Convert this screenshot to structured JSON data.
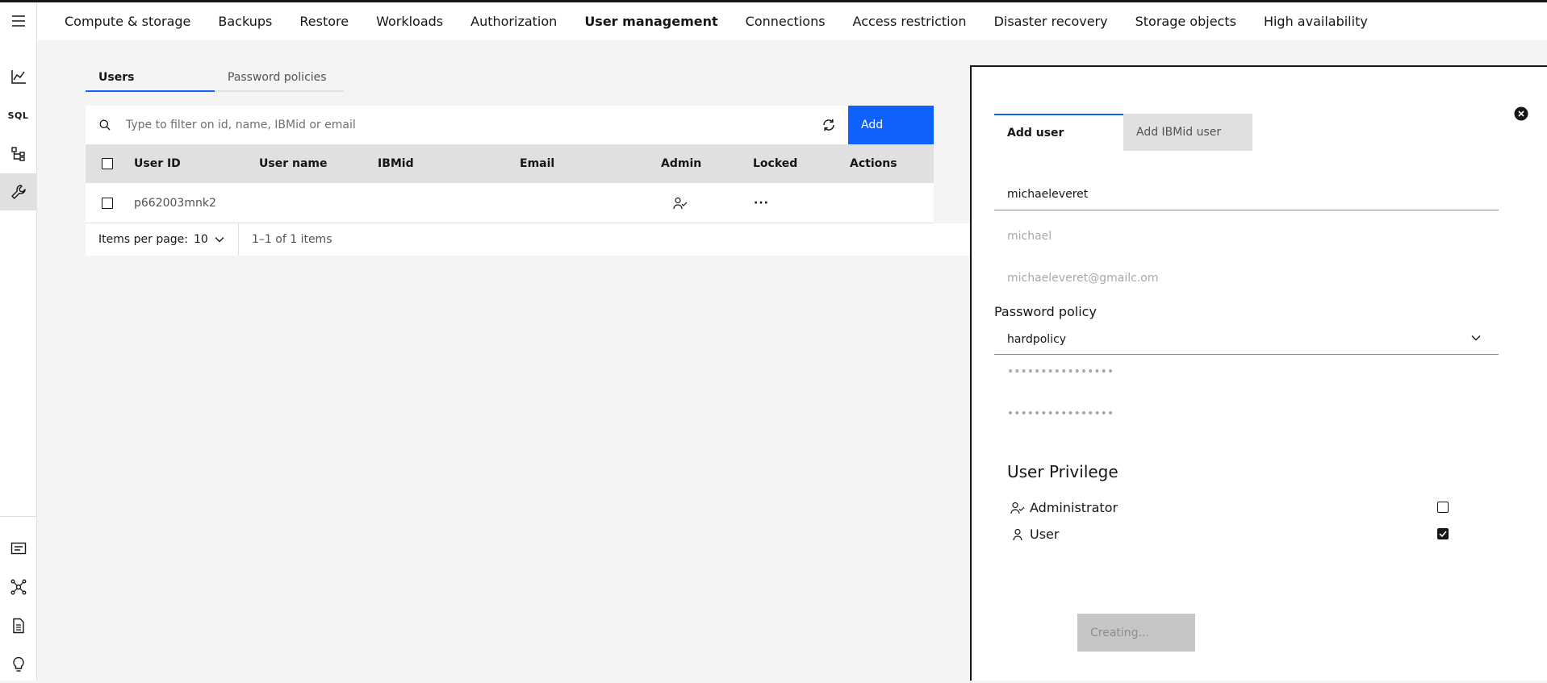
{
  "topnav": {
    "items": [
      "Compute & storage",
      "Backups",
      "Restore",
      "Workloads",
      "Authorization",
      "User management",
      "Connections",
      "Access restriction",
      "Disaster recovery",
      "Storage objects",
      "High availability"
    ],
    "active": "User management"
  },
  "rail": {
    "sql_label": "SQL"
  },
  "tabs": {
    "users": "Users",
    "password_policies": "Password policies"
  },
  "toolbar": {
    "search_placeholder": "Type to filter on id, name, IBMid or email",
    "add_label": "Add"
  },
  "table": {
    "headers": {
      "user_id": "User ID",
      "user_name": "User name",
      "ibmid": "IBMid",
      "email": "Email",
      "admin": "Admin",
      "locked": "Locked",
      "actions": "Actions"
    },
    "rows": [
      {
        "user_id": "p662003mnk2",
        "user_name": "",
        "ibmid": "",
        "email": "",
        "admin": true,
        "locked": "···"
      }
    ]
  },
  "pagination": {
    "label": "Items per page:",
    "per_page": "10",
    "range": "1–1 of 1 items"
  },
  "panel": {
    "tabs": {
      "add_user": "Add user",
      "add_ibmid_user": "Add IBMid user"
    },
    "user_id_value": "michaeleveret",
    "name_placeholder": "michael",
    "email_placeholder": "michaeleveret@gmailc.om",
    "password_policy_label": "Password policy",
    "password_policy_value": "hardpolicy",
    "password_placeholder": "••••••••••••••••",
    "confirm_password_placeholder": "••••••••••••••••",
    "privilege_title": "User Privilege",
    "privileges": [
      {
        "label": "Administrator",
        "checked": false
      },
      {
        "label": "User",
        "checked": true
      }
    ],
    "submit_label": "Creating..."
  },
  "colors": {
    "primary": "#0f62fe",
    "header_bg": "#e0e0e0",
    "page_bg": "#f4f4f4",
    "disabled_bg": "#c6c6c6"
  }
}
